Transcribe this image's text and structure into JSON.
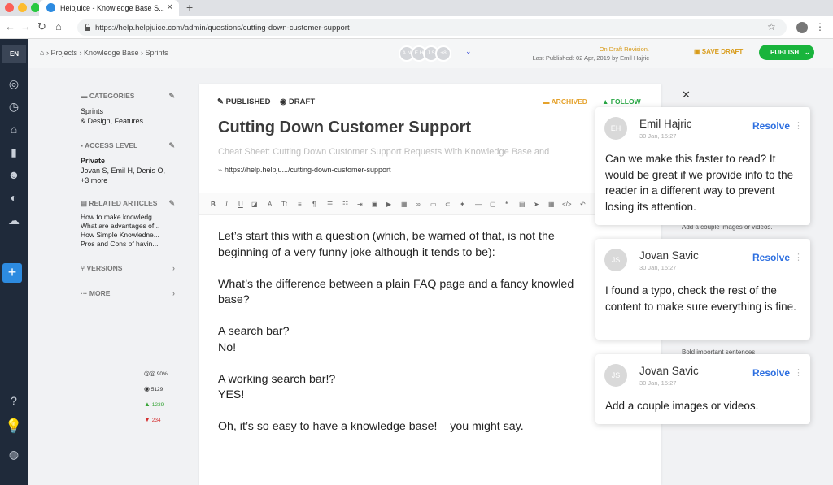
{
  "browser": {
    "tab_title": "Helpjuice - Knowledge Base S...",
    "url": "https://help.helpjuice.com/admin/questions/cutting-down-customer-support"
  },
  "rail": {
    "lang": "EN"
  },
  "topbar": {
    "breadcrumb": "› Projects › Knowledge Base › Sprints",
    "avatars": [
      "A.N",
      "E.H",
      "J.S",
      "+8"
    ],
    "draft_status": "On Draft Revision.",
    "last_published": "Last Published: 02 Apr, 2019 by Emil Hajric",
    "save_draft": "SAVE DRAFT",
    "publish": "PUBLISH"
  },
  "meta": {
    "categories_label": "CATEGORIES",
    "categories": [
      "Sprints",
      "& Design, Features"
    ],
    "access_label": "ACCESS LEVEL",
    "access_value": "Private",
    "access_users": "Jovan S, Emil H, Denis O, +3 more",
    "related_label": "RELATED ARTICLES",
    "related": [
      "How to make knowledg...",
      "What are advantages of...",
      "How Simple Knowledne...",
      "Pros and Cons of havin..."
    ],
    "versions_label": "VERSIONS",
    "more_label": "MORE",
    "stats": {
      "read": "90%",
      "views": "5129",
      "likes": "1239",
      "dislikes": "234"
    }
  },
  "editor": {
    "published": "PUBLISHED",
    "draft": "DRAFT",
    "archived": "ARCHIVED",
    "follow": "FOLLOW",
    "title": "Cutting Down Customer Support",
    "subtitle": "Cheat Sheet: Cutting Down Customer Support Requests With Knowledge Base and",
    "url": "https://help.helpju.../cutting-down-customer-support",
    "body": [
      "Let’s start this with a question (which, be warned of that, is not the",
      "beginning of a very funny joke although it tends to be):",
      "What’s the difference between a plain FAQ page and a fancy knowled",
      "base?",
      "A search bar?",
      "No!",
      "A working search bar!?",
      "YES!",
      "Oh, it’s so easy to have a knowledge base! – you might say."
    ]
  },
  "ghost_notes": [
    "Add a couple images or videos.",
    "Bold important sentences"
  ],
  "comments": [
    {
      "initials": "EH",
      "author": "Emil Hajric",
      "date": "30 Jan, 15:27",
      "resolve": "Resolve",
      "text": "Can we make this faster to read? It would be great if we provide info to the reader in a different way to prevent losing its attention."
    },
    {
      "initials": "JS",
      "author": "Jovan Savic",
      "date": "30 Jan, 15:27",
      "resolve": "Resolve",
      "text": "I found a typo, check the rest of the content to make sure everything is fine."
    },
    {
      "initials": "JS",
      "author": "Jovan Savic",
      "date": "30 Jan, 15:27",
      "resolve": "Resolve",
      "text": "Add a couple images or videos."
    }
  ],
  "colors": {
    "accent": "#2d6fe0",
    "publish": "#19b43c",
    "rail": "#1f2a3a",
    "archived": "#e5a22b",
    "follow": "#29a745"
  }
}
